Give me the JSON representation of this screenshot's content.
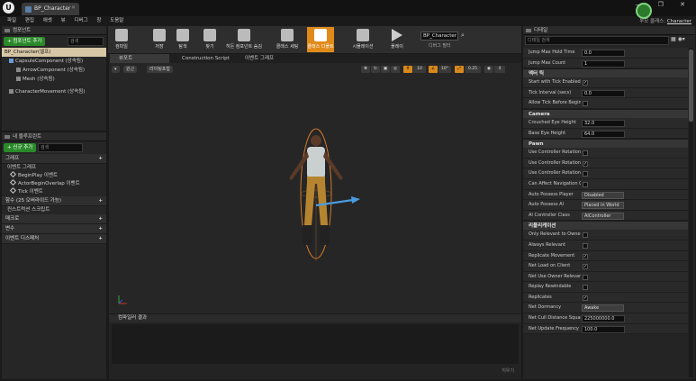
{
  "window": {
    "app_logo": "U",
    "tab_title": "BP_Character",
    "parent_class_label": "부모 클래스:",
    "parent_class_value": "Character",
    "close_tab": "✕",
    "controls": "— ❐ ✕"
  },
  "menu": [
    "파일",
    "편집",
    "애셋",
    "뷰",
    "디버그",
    "창",
    "도움말"
  ],
  "toolbar": {
    "items": [
      {
        "label": "컴파일",
        "icon": "compile-icon"
      },
      {
        "label": "저장",
        "icon": "save-icon"
      },
      {
        "label": "탐색",
        "icon": "browse-icon"
      },
      {
        "label": "찾기",
        "icon": "find-icon"
      },
      {
        "label": "클래스 세팅",
        "icon": "class-settings-icon"
      },
      {
        "label": "클래스 디폴트",
        "icon": "class-defaults-icon"
      },
      {
        "label": "시뮬레이션",
        "icon": "simulation-icon"
      },
      {
        "label": "플레이",
        "icon": "play-icon"
      }
    ],
    "hidden_component_label": "히든 컴포넌트 숨김",
    "debug_filter_value": "BP_Character",
    "debug_filter_label": "디버그 필터"
  },
  "components": {
    "header": "컴포넌트",
    "add_button": "+ 컴포넌트 추가",
    "search_placeholder": "검색",
    "root": "BP_Character(셀프)",
    "items": [
      "CapsuleComponent (상속됨)",
      "ArrowComponent (상속됨)",
      "Mesh (상속됨)",
      "CharacterMovement (상속됨)"
    ]
  },
  "my_blueprint": {
    "header": "내 블루프린트",
    "add_button": "+ 신규 추가",
    "search_placeholder": "검색",
    "graphs_label": "그래프",
    "event_graph_label": "이벤트 그래프",
    "events": [
      "BeginPlay 이벤트",
      "ActorBeginOverlap 이벤트",
      "Tick 이벤트"
    ],
    "functions_label": "함수 (25 오버라이드 가능)",
    "construction_script": "컨스트럭션 스크립트",
    "macros_label": "매크로",
    "variables_label": "변수",
    "dispatchers_label": "이벤트 디스패처"
  },
  "editor_tabs": [
    "뷰포트",
    "Construction Script",
    "이벤트 그래프"
  ],
  "viewport": {
    "perspective": "원근",
    "lit": "라이팅포함",
    "snap_values": [
      "10",
      "10°",
      "0.25",
      "4"
    ]
  },
  "compiler": {
    "header": "컴파일러 결과",
    "clear": "지우기"
  },
  "details": {
    "header": "디테일",
    "search_placeholder": "디테일 검색",
    "sections": [
      {
        "title": "",
        "rows": [
          {
            "label": "Jump Max Hold Time",
            "type": "num",
            "value": "0.0"
          },
          {
            "label": "Jump Max Count",
            "type": "num",
            "value": "1"
          }
        ]
      },
      {
        "title": "액터 틱",
        "rows": [
          {
            "label": "Start with Tick Enabled",
            "type": "chk",
            "value": "✓"
          },
          {
            "label": "Tick Interval (secs)",
            "type": "num",
            "value": "0.0"
          },
          {
            "label": "Allow Tick Before Begin",
            "type": "chk",
            "value": ""
          }
        ]
      },
      {
        "title": "Camera",
        "rows": [
          {
            "label": "Crouched Eye Height",
            "type": "num",
            "value": "32.0"
          },
          {
            "label": "Base Eye Height",
            "type": "num",
            "value": "64.0"
          }
        ]
      },
      {
        "title": "Pawn",
        "rows": [
          {
            "label": "Use Controller Rotation",
            "type": "chk",
            "value": ""
          },
          {
            "label": "Use Controller Rotation",
            "type": "chk",
            "value": "✓"
          },
          {
            "label": "Use Controller Rotation",
            "type": "chk",
            "value": ""
          },
          {
            "label": "Can Affect Navigation G",
            "type": "chk",
            "value": ""
          },
          {
            "label": "Auto Possess Player",
            "type": "dd",
            "value": "Disabled"
          },
          {
            "label": "Auto Possess AI",
            "type": "dd",
            "value": "Placed in World"
          },
          {
            "label": "AI Controller Class",
            "type": "dd",
            "value": "AIController"
          }
        ]
      },
      {
        "title": "리플리케이션",
        "rows": [
          {
            "label": "Only Relevant to Owner",
            "type": "chk",
            "value": ""
          },
          {
            "label": "Always Relevant",
            "type": "chk",
            "value": ""
          },
          {
            "label": "Replicate Movement",
            "type": "chk",
            "value": "✓"
          },
          {
            "label": "Net Load on Client",
            "type": "chk",
            "value": "✓"
          },
          {
            "label": "Net Use Owner Relevan",
            "type": "chk",
            "value": ""
          },
          {
            "label": "Replay Rewindable",
            "type": "chk",
            "value": ""
          },
          {
            "label": "Replicates",
            "type": "chk",
            "value": "✓"
          },
          {
            "label": "Net Dormancy",
            "type": "dd",
            "value": "Awake"
          },
          {
            "label": "Net Cull Distance Squar",
            "type": "num",
            "value": "225000000.0"
          },
          {
            "label": "Net Update Frequency",
            "type": "num",
            "value": "100.0"
          }
        ]
      }
    ]
  }
}
